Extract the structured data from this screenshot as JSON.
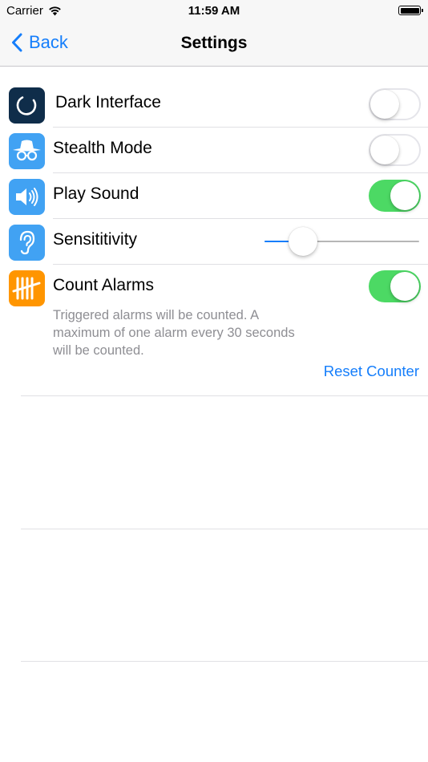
{
  "status_bar": {
    "carrier": "Carrier",
    "time": "11:59 AM",
    "wifi_icon": "wifi-icon",
    "battery_icon": "battery-icon"
  },
  "nav": {
    "back_label": "Back",
    "title": "Settings",
    "back_icon": "chevron-left-icon"
  },
  "colors": {
    "accent": "#157efb",
    "toggle_on": "#4cd964",
    "icon_dark": "#0f2d4a",
    "icon_blue": "#41a2f3",
    "icon_orange": "#ff9500"
  },
  "settings": {
    "dark_interface": {
      "label": "Dark Interface",
      "icon": "dark-interface-icon",
      "enabled": false
    },
    "stealth_mode": {
      "label": "Stealth Mode",
      "icon": "stealth-mode-icon",
      "enabled": false
    },
    "play_sound": {
      "label": "Play Sound",
      "icon": "speaker-icon",
      "enabled": true
    },
    "sensitivity": {
      "label": "Sensititivity",
      "icon": "ear-icon",
      "value": 0.25
    },
    "count_alarms": {
      "label": "Count Alarms",
      "icon": "tally-icon",
      "enabled": true,
      "description_line1": "Triggered alarms will be counted. A",
      "description_line2": "maximum of one alarm every 30 seconds",
      "description_line3": "will be counted.",
      "reset_label": "Reset Counter"
    }
  }
}
